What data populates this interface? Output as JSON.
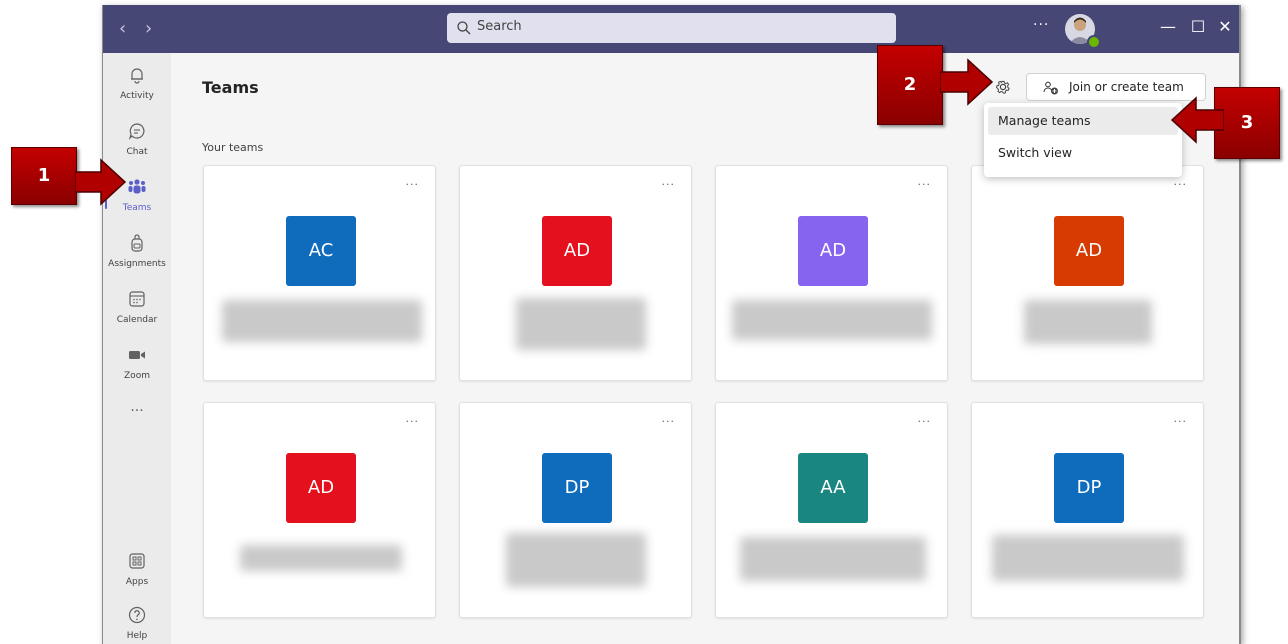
{
  "titlebar": {
    "back_icon": "chevron-left-icon",
    "forward_icon": "chevron-right-icon",
    "search_placeholder": "Search",
    "more_label": "···",
    "minimize": "—",
    "maximize": "☐",
    "close": "✕"
  },
  "rail": {
    "items": [
      {
        "label": "Activity",
        "icon": "bell-icon"
      },
      {
        "label": "Chat",
        "icon": "chat-icon"
      },
      {
        "label": "Teams",
        "icon": "teams-icon",
        "active": true
      },
      {
        "label": "Assignments",
        "icon": "backpack-icon"
      },
      {
        "label": "Calendar",
        "icon": "calendar-icon"
      },
      {
        "label": "Zoom",
        "icon": "video-icon"
      }
    ],
    "more": "···",
    "bottom": [
      {
        "label": "Apps",
        "icon": "apps-icon"
      },
      {
        "label": "Help",
        "icon": "help-icon"
      }
    ]
  },
  "main": {
    "title": "Teams",
    "join_label": "Join or create team",
    "section_label": "Your teams",
    "card_menu": "···",
    "teams": [
      {
        "initials": "AC",
        "color": "#0f6cbd"
      },
      {
        "initials": "AD",
        "color": "#e5101d"
      },
      {
        "initials": "AD",
        "color": "#8764f0"
      },
      {
        "initials": "AD",
        "color": "#d83b01"
      },
      {
        "initials": "AD",
        "color": "#e5101d"
      },
      {
        "initials": "DP",
        "color": "#0f6cbd"
      },
      {
        "initials": "AA",
        "color": "#1a8682"
      },
      {
        "initials": "DP",
        "color": "#0f6cbd"
      }
    ]
  },
  "dropdown": {
    "items": [
      "Manage teams",
      "Switch view"
    ]
  },
  "callouts": [
    "1",
    "2",
    "3"
  ],
  "colors": {
    "titlebar": "#464775",
    "accent": "#5b5fc7",
    "callout": "#b00000"
  }
}
